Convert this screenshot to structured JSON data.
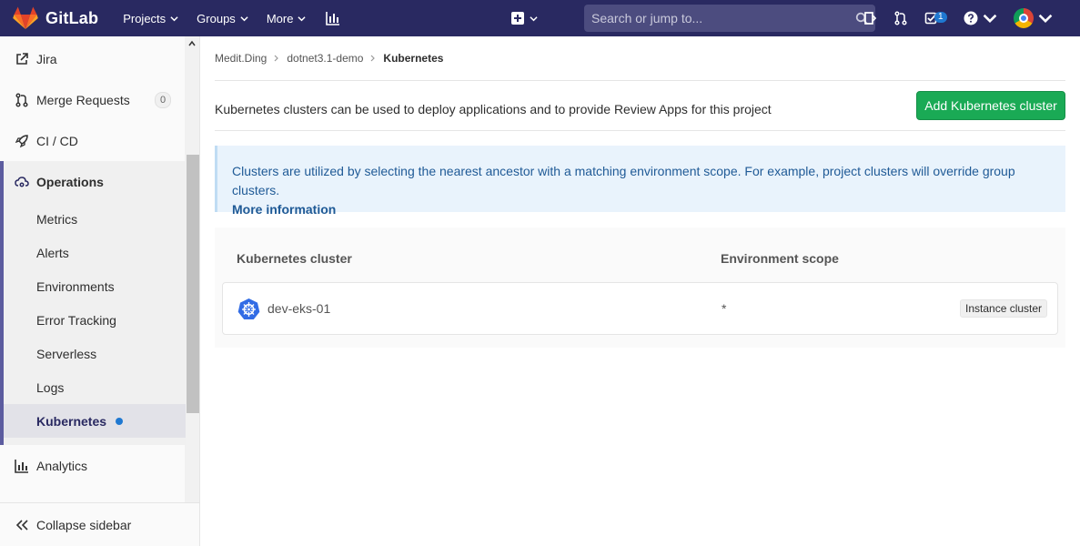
{
  "navbar": {
    "brand": "GitLab",
    "menu": [
      {
        "label": "Projects"
      },
      {
        "label": "Groups"
      },
      {
        "label": "More"
      }
    ],
    "search_placeholder": "Search or jump to...",
    "todo_count": "1",
    "colors": {
      "bg": "#292961",
      "search_bg": "#4c4c7f"
    }
  },
  "sidebar": {
    "items": [
      {
        "label": "Jira",
        "icon": "external-link-icon"
      },
      {
        "label": "Merge Requests",
        "icon": "merge-request-icon",
        "count": "0"
      },
      {
        "label": "CI / CD",
        "icon": "rocket-icon"
      }
    ],
    "operations": {
      "label": "Operations",
      "icon": "cloud-gear-icon",
      "sub_items": [
        {
          "label": "Metrics"
        },
        {
          "label": "Alerts"
        },
        {
          "label": "Environments"
        },
        {
          "label": "Error Tracking"
        },
        {
          "label": "Serverless"
        },
        {
          "label": "Logs"
        }
      ],
      "active_item": "Kubernetes"
    },
    "analytics": {
      "label": "Analytics",
      "icon": "chart-icon"
    },
    "collapse_label": "Collapse sidebar"
  },
  "breadcrumb": {
    "items": [
      "Medit.Ding",
      "dotnet3.1-demo"
    ],
    "current": "Kubernetes"
  },
  "main": {
    "intro": "Kubernetes clusters can be used to deploy applications and to provide Review Apps for this project",
    "add_button": "Add Kubernetes cluster",
    "info": {
      "text": "Clusters are utilized by selecting the nearest ancestor with a matching environment scope. For example, project clusters will override group clusters.",
      "link": "More information"
    },
    "table": {
      "headers": {
        "cluster": "Kubernetes cluster",
        "scope": "Environment scope"
      },
      "rows": [
        {
          "name": "dev-eks-01",
          "scope": "*",
          "type": "Instance cluster"
        }
      ]
    },
    "colors": {
      "accent_green": "#1aaa55",
      "info_bg": "#e9f3fc",
      "info_text": "#1f5a96",
      "k8s_blue": "#326ce5"
    }
  }
}
